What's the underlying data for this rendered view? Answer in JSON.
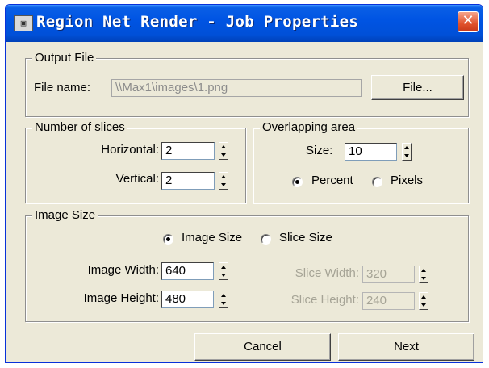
{
  "window": {
    "title": "Region Net Render - Job Properties",
    "app_icon_glyph": "▣",
    "close_glyph": "✕",
    "title_bar_color": "#0054e3",
    "dialog_bg": "#ece9d8"
  },
  "output_file": {
    "group_label": "Output File",
    "file_name_label": "File name:",
    "file_name_value": "\\\\Max1\\images\\1.png",
    "file_button": "File..."
  },
  "slices": {
    "group_label": "Number of slices",
    "horizontal_label": "Horizontal:",
    "horizontal_value": "2",
    "vertical_label": "Vertical:",
    "vertical_value": "2"
  },
  "overlap": {
    "group_label": "Overlapping area",
    "size_label": "Size:",
    "size_value": "10",
    "unit_options": [
      {
        "label": "Percent",
        "selected": true
      },
      {
        "label": "Pixels",
        "selected": false
      }
    ]
  },
  "image_size": {
    "group_label": "Image Size",
    "mode_options": [
      {
        "label": "Image Size",
        "selected": true
      },
      {
        "label": "Slice Size",
        "selected": false
      }
    ],
    "image_width_label": "Image Width:",
    "image_width_value": "640",
    "image_height_label": "Image Height:",
    "image_height_value": "480",
    "slice_width_label": "Slice Width:",
    "slice_width_value": "320",
    "slice_height_label": "Slice Height:",
    "slice_height_value": "240"
  },
  "buttons": {
    "cancel": "Cancel",
    "next": "Next"
  }
}
